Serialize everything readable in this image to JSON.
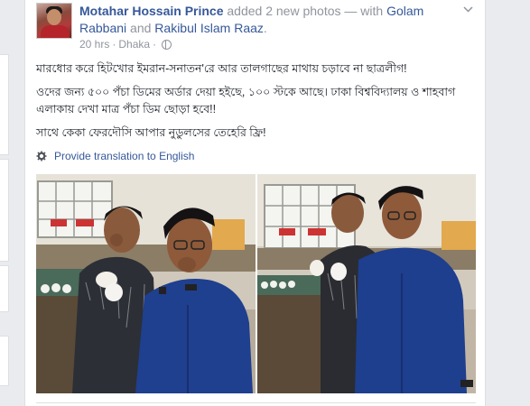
{
  "post": {
    "author": "Motahar Hossain Prince",
    "action_text": "added 2 new photos — with",
    "tagged_1": "Golam Rabbani",
    "and_text": "and",
    "tagged_2": "Rakibul Islam Raaz",
    "period": ".",
    "time": "20 hrs",
    "separator": "·",
    "location": "Dhaka",
    "separator2": "·",
    "text_lines": [
      "মারধোর করে হিটখোর ইমরান-সনাতন'রে আর তালগাছের মাথায় চড়াবে না ছাত্রলীগ!",
      "ওদের জন্য ৫০০ পঁচা ডিমের অর্ডার দেয়া হইছে, ১০০ স্টকে আছে। ঢাকা বিশ্ববিদ্যালয় ও শাহবাগ এলাকায় দেখা মাত্র পঁচা ডিম ছোড়া হবে!!",
      "সাথে কেকা ফেরদৌসি আপার নুডুলসের তেহেরি ফ্রি!"
    ],
    "translate_label": "Provide translation to English"
  },
  "icons": {
    "avatar": "profile-photo",
    "privacy": "globe-icon",
    "menu": "chevron-down-icon",
    "translate": "gear-icon"
  },
  "colors": {
    "link": "#365899",
    "muted": "#90949c",
    "text": "#1d2129",
    "background": "#e9ebee"
  }
}
